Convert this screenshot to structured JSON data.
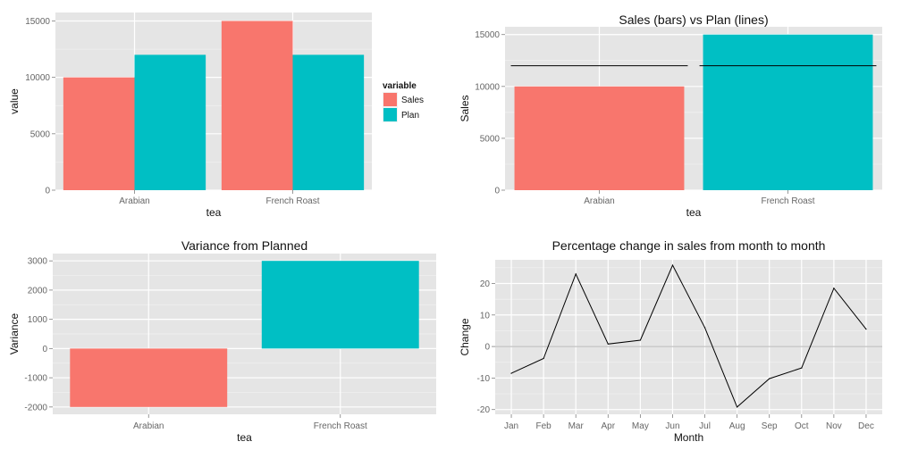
{
  "colors": {
    "sales": "#F8766D",
    "plan": "#00BFC4",
    "panel": "#E5E5E5",
    "grid_major": "#FFFFFF",
    "grid_minor": "#F2F2F2",
    "line": "#000000",
    "zero_line": "#B4B4B4"
  },
  "chart_data": [
    {
      "type": "bar",
      "title": "",
      "xlabel": "tea",
      "ylabel": "value",
      "categories": [
        "Arabian",
        "French Roast"
      ],
      "series": [
        {
          "name": "Sales",
          "values": [
            10000,
            15000
          ]
        },
        {
          "name": "Plan",
          "values": [
            12000,
            12000
          ]
        }
      ],
      "ylim": [
        0,
        15750
      ],
      "yticks": [
        0,
        5000,
        10000,
        15000
      ],
      "legend": {
        "title": "variable",
        "entries": [
          "Sales",
          "Plan"
        ],
        "placement": "right"
      },
      "grid": true
    },
    {
      "type": "bar",
      "title": "Sales (bars) vs Plan (lines)",
      "xlabel": "tea",
      "ylabel": "Sales",
      "categories": [
        "Arabian",
        "French Roast"
      ],
      "values": [
        10000,
        15000
      ],
      "plan_values": [
        12000,
        12000
      ],
      "ylim": [
        0,
        15750
      ],
      "yticks": [
        0,
        5000,
        10000,
        15000
      ],
      "grid": true
    },
    {
      "type": "bar",
      "title": "Variance from Planned",
      "xlabel": "tea",
      "ylabel": "Variance",
      "categories": [
        "Arabian",
        "French Roast"
      ],
      "values": [
        -2000,
        3000
      ],
      "ylim": [
        -2250,
        3250
      ],
      "yticks": [
        -2000,
        -1000,
        0,
        1000,
        2000,
        3000
      ],
      "grid": true
    },
    {
      "type": "line",
      "title": "Percentage change in sales from month to month",
      "xlabel": "Month",
      "ylabel": "Change",
      "categories": [
        "Jan",
        "Feb",
        "Mar",
        "Apr",
        "May",
        "Jun",
        "Jul",
        "Aug",
        "Sep",
        "Oct",
        "Nov",
        "Dec"
      ],
      "values": [
        -8.5,
        -3.8,
        23,
        0.8,
        2,
        25.8,
        6,
        -19.2,
        -10.2,
        -6.8,
        18.5,
        5.5
      ],
      "ylim": [
        -21.5,
        27.5
      ],
      "yticks": [
        -20,
        -10,
        0,
        10,
        20
      ],
      "grid": true
    }
  ]
}
